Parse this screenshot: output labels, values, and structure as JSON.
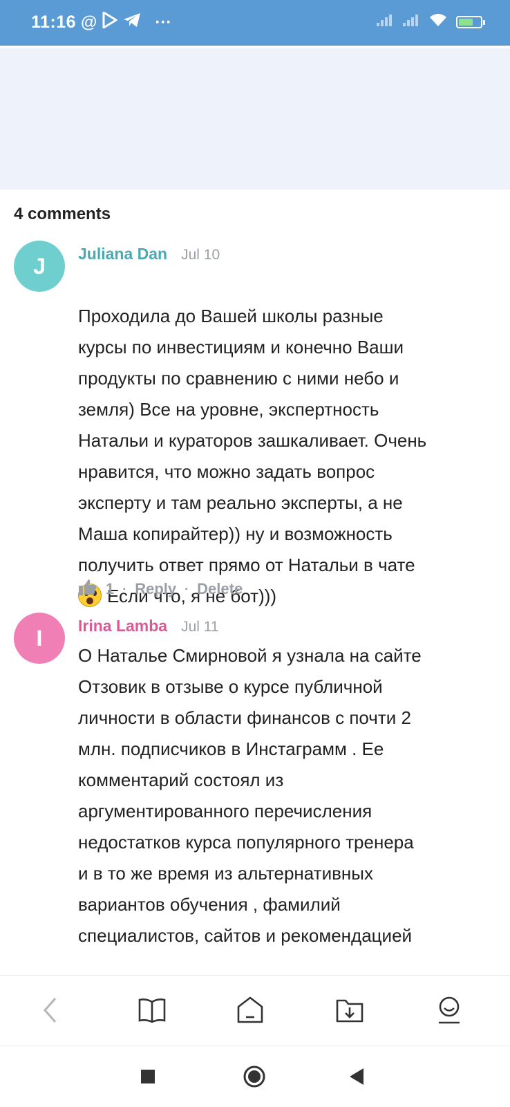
{
  "status_bar": {
    "time": "11:16",
    "left_icons": [
      "at-sign-icon",
      "play-store-icon",
      "telegram-icon",
      "more-dots-icon"
    ],
    "more": "···",
    "at": "@",
    "right_icons": [
      "signal-icon",
      "signal-icon",
      "wifi-icon",
      "battery-charging-icon"
    ],
    "color": "#5b9bd5"
  },
  "comments_header": "4 comments",
  "comments": [
    {
      "avatar_letter": "J",
      "avatar_color": "#6fcfcf",
      "author": "Juliana Dan",
      "author_color": "#4aa9b3",
      "date": "Jul 10",
      "text": "Проходила до Вашей школы разные\nкурсы по инвестициям и конечно Ваши\nпродукты по сравнению с ними небо и\nземля) Все на уровне, экспертность\nНатальи и кураторов зашкаливает. Очень\nнравится, что можно задать вопрос\nэксперту и там реально эксперты, а не\nМаша копирайтер)) ну и возможность\nполучить ответ прямо от Натальи в чате",
      "text_last": "Если что, я не бот)))",
      "emoji": "screaming-face-emoji",
      "likes": "1",
      "reply": "Reply",
      "delete": "Delete"
    },
    {
      "avatar_letter": "I",
      "avatar_color": "#f07fb6",
      "author": "Irina Lamba",
      "author_color": "#d95b96",
      "date": "Jul 11",
      "text": "О Наталье Смирновой я узнала на сайте\nОтзовик в отзыве о курсе публичной\nличности в области финансов с почти 2\nмлн. подписчиков в Инстаграмм . Ее\nкомментарий состоял из\nаргументированного перечисления\nнедостатков курса популярного тренера\nи в то же время из альтернативных\nвариантов обучения , фамилий\nспециалистов, сайтов и рекомендацией"
    }
  ],
  "bottom_nav": [
    "back-icon",
    "book-icon",
    "home-icon",
    "download-icon",
    "profile-icon"
  ],
  "system_nav": [
    "recents-icon",
    "home-circle-icon",
    "back-triangle-icon"
  ]
}
